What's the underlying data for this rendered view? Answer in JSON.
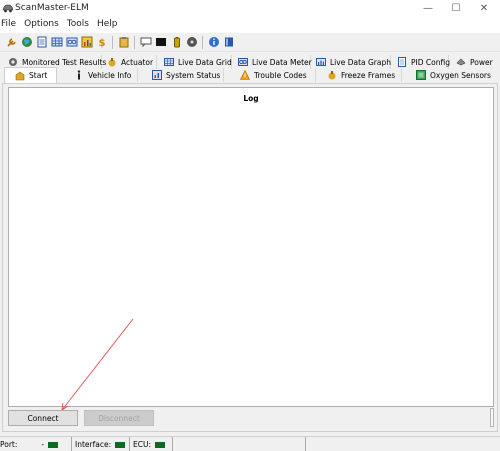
{
  "window": {
    "title": "ScanMaster-ELM",
    "min_glyph": "—",
    "max_glyph": "☐",
    "close_glyph": "✕"
  },
  "menu": [
    "File",
    "Options",
    "Tools",
    "Help"
  ],
  "toolbar": {
    "icons": [
      "wrench-icon",
      "globe-icon",
      "document-icon",
      "grid-icon",
      "meter-icon",
      "chart-icon",
      "dollar-icon",
      "clipboard-icon",
      "chat-icon",
      "terminal-icon",
      "battery-icon",
      "disc-icon",
      "info-icon",
      "book-icon"
    ]
  },
  "tabs_row1": [
    {
      "label": "Monitored Test Results",
      "icon": "gear-icon"
    },
    {
      "label": "Actuator",
      "icon": "actuator-icon"
    },
    {
      "label": "Live Data Grid",
      "icon": "grid-icon"
    },
    {
      "label": "Live Data Meter",
      "icon": "meter-icon"
    },
    {
      "label": "Live Data Graph",
      "icon": "graph-icon"
    },
    {
      "label": "PID Config",
      "icon": "pid-icon"
    },
    {
      "label": "Power",
      "icon": "power-icon"
    }
  ],
  "tabs_row2": [
    {
      "label": "Start",
      "icon": "start-icon",
      "active": true
    },
    {
      "label": "Vehicle Info",
      "icon": "info-icon"
    },
    {
      "label": "System Status",
      "icon": "status-icon"
    },
    {
      "label": "Trouble Codes",
      "icon": "warning-icon"
    },
    {
      "label": "Freeze Frames",
      "icon": "freeze-icon"
    },
    {
      "label": "Oxygen Sensors",
      "icon": "oxygen-icon"
    }
  ],
  "log": {
    "title": "Log"
  },
  "buttons": {
    "connect": "Connect",
    "disconnect": "Disconnect"
  },
  "status": {
    "port_label": "Port:",
    "port_value": "-",
    "interface_label": "Interface:",
    "ecu_label": "ECU:",
    "led_color": "#0c6a25"
  },
  "colors": {
    "window_bg": "#f0f0f0",
    "annotation_arrow": "#d9534f"
  }
}
